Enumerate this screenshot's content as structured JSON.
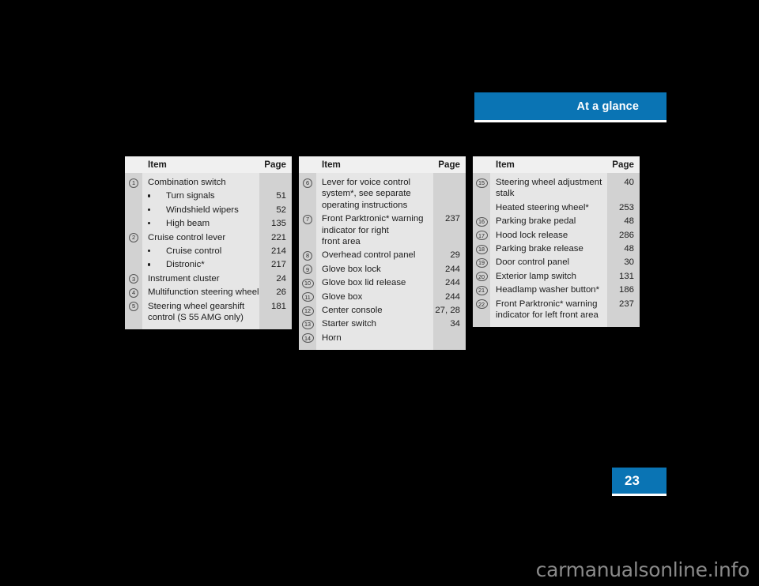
{
  "header": {
    "title": "At a glance",
    "accent_color": "#0a74b4"
  },
  "page_number": "23",
  "watermark": "carmanualsonline.info",
  "tables": [
    {
      "columns": {
        "item": "Item",
        "page": "Page"
      },
      "rows": [
        {
          "num": "1",
          "label": "Combination switch",
          "page": ""
        },
        {
          "bullet": true,
          "label": "Turn signals",
          "page": "51"
        },
        {
          "bullet": true,
          "label": "Windshield wipers",
          "page": "52"
        },
        {
          "bullet": true,
          "label": "High beam",
          "page": "135"
        },
        {
          "num": "2",
          "label": "Cruise control lever",
          "page": "221"
        },
        {
          "bullet": true,
          "label": "Cruise control",
          "page": "214"
        },
        {
          "bullet": true,
          "label": "Distronic*",
          "page": "217"
        },
        {
          "num": "3",
          "label": "Instrument cluster",
          "page": "24"
        },
        {
          "num": "4",
          "label": "Multifunction steering wheel",
          "page": "26"
        },
        {
          "num": "5",
          "label": "Steering wheel gearshift control (S 55 AMG only)",
          "page": "181"
        }
      ]
    },
    {
      "columns": {
        "item": "Item",
        "page": "Page"
      },
      "rows": [
        {
          "num": "6",
          "label": "Lever for voice control system*, see separate operating instructions",
          "page": ""
        },
        {
          "num": "7",
          "label": "Front Parktronic* warning indicator for right\nfront area",
          "page": "237"
        },
        {
          "num": "8",
          "label": "Overhead control panel",
          "page": "29"
        },
        {
          "num": "9",
          "label": "Glove box lock",
          "page": "244"
        },
        {
          "num": "10",
          "label": "Glove box lid release",
          "page": "244"
        },
        {
          "num": "11",
          "label": "Glove box",
          "page": "244"
        },
        {
          "num": "12",
          "label": "Center console",
          "page": "27, 28"
        },
        {
          "num": "13",
          "label": "Starter switch",
          "page": "34"
        },
        {
          "num": "14",
          "label": "Horn",
          "page": ""
        }
      ]
    },
    {
      "columns": {
        "item": "Item",
        "page": "Page"
      },
      "rows": [
        {
          "num": "15",
          "label": "Steering wheel adjustment stalk",
          "page": "40"
        },
        {
          "label": "Heated steering wheel*",
          "page": "253"
        },
        {
          "num": "16",
          "label": "Parking brake pedal",
          "page": "48"
        },
        {
          "num": "17",
          "label": "Hood lock release",
          "page": "286"
        },
        {
          "num": "18",
          "label": "Parking brake release",
          "page": "48"
        },
        {
          "num": "19",
          "label": "Door control panel",
          "page": "30"
        },
        {
          "num": "20",
          "label": "Exterior lamp switch",
          "page": "131"
        },
        {
          "num": "21",
          "label": "Headlamp washer button*",
          "page": "186"
        },
        {
          "num": "22",
          "label": "Front Parktronic* warning indicator for left front area",
          "page": "237"
        }
      ]
    }
  ]
}
